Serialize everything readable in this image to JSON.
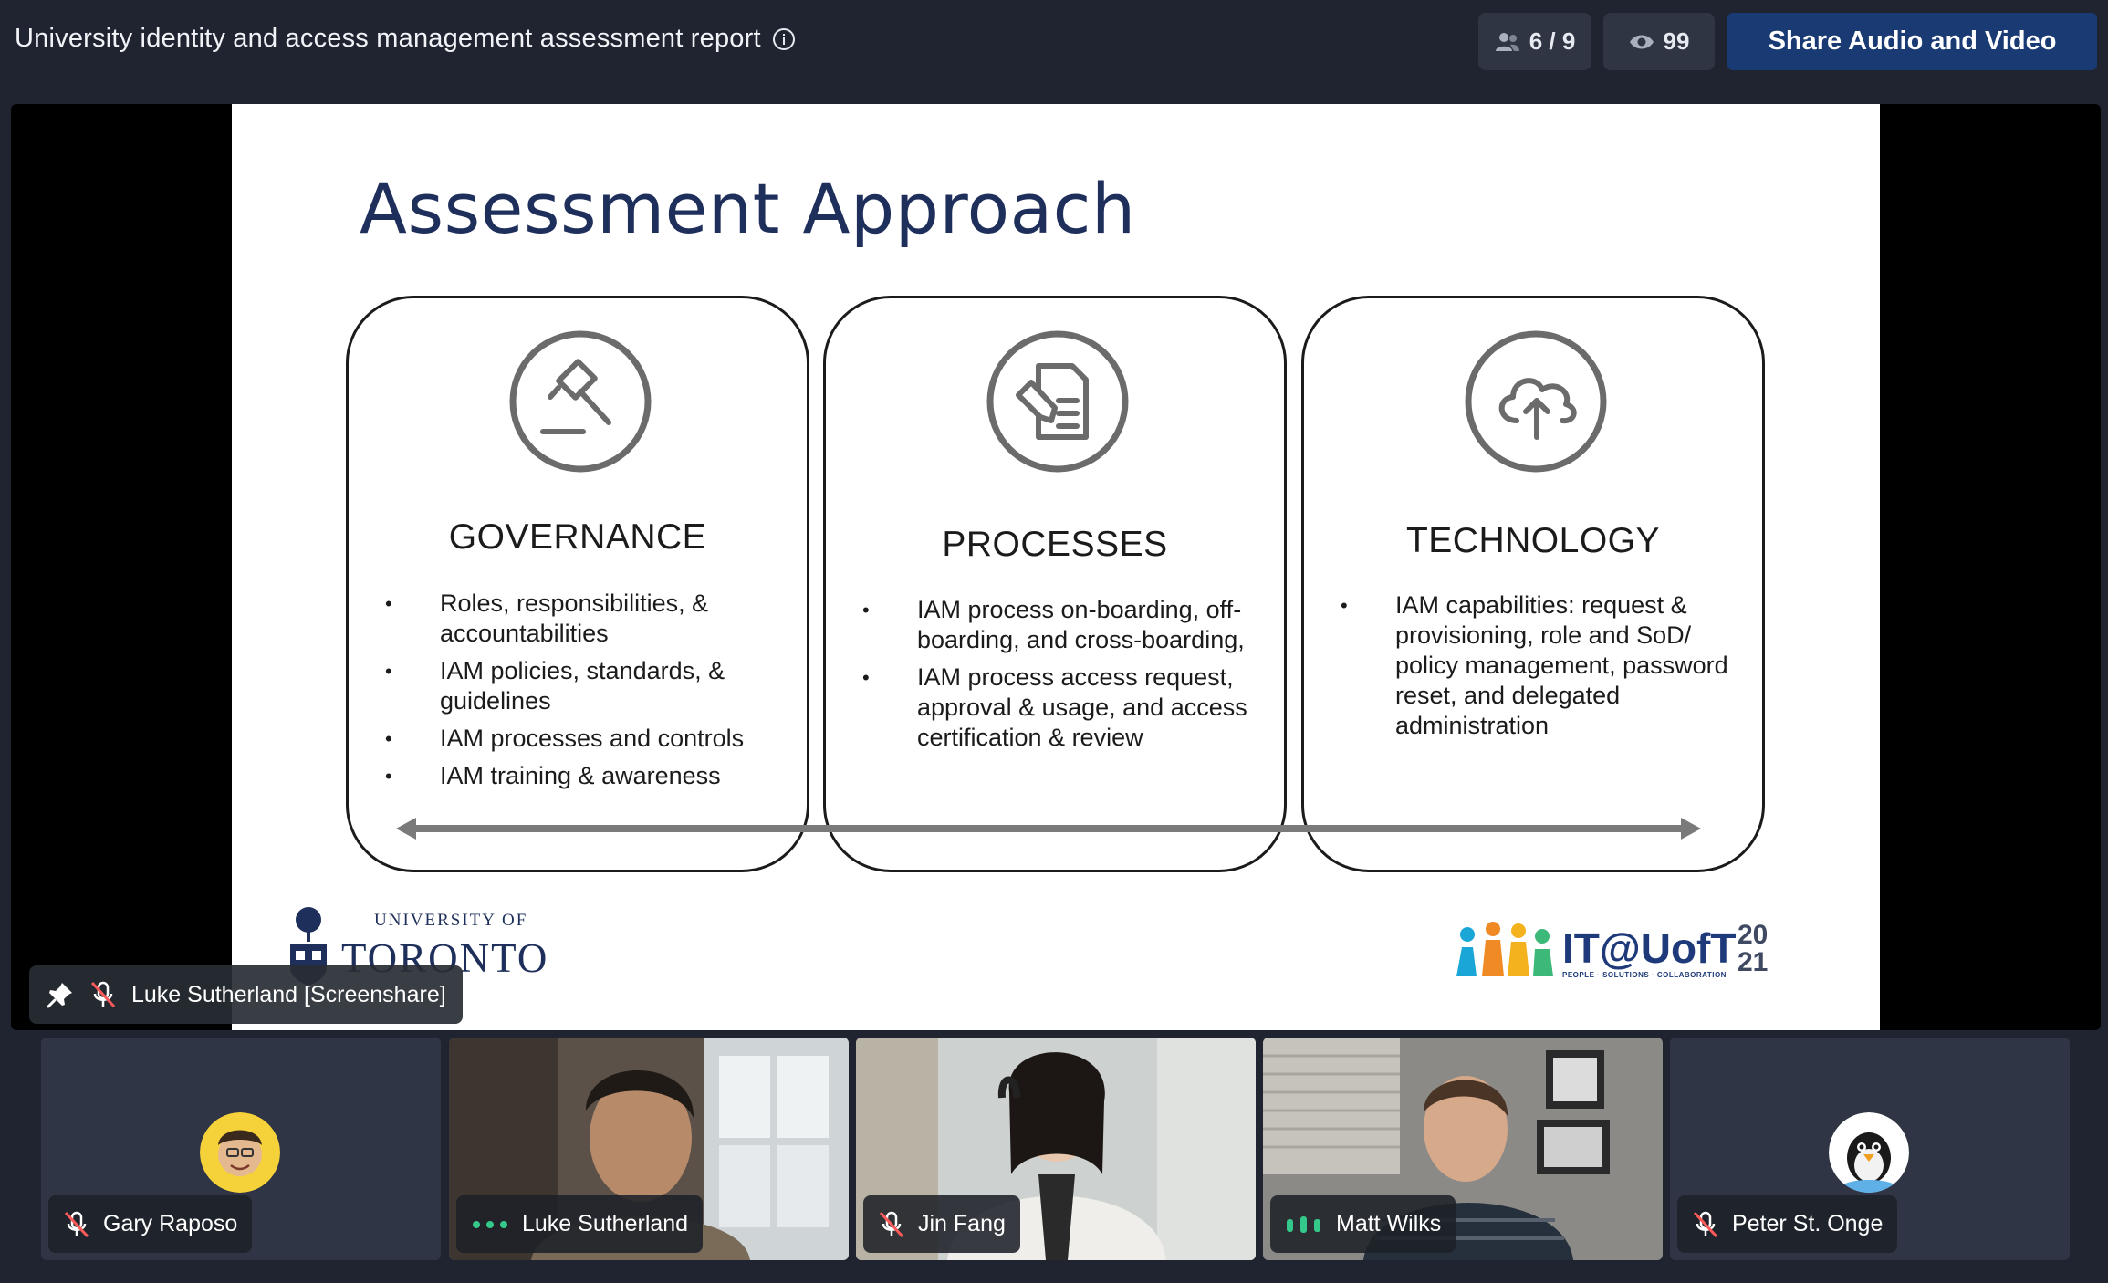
{
  "header": {
    "title": "University identity and access management assessment report",
    "participants_count": "6 / 9",
    "viewers_count": "99",
    "share_button": "Share Audio and Video"
  },
  "slide": {
    "title": "Assessment Approach",
    "panels": [
      {
        "heading": "GOVERNANCE",
        "icon": "gavel-icon",
        "bullets": [
          "Roles, responsibilities, & accountabilities",
          "IAM policies, standards, & guidelines",
          "IAM processes and controls",
          "IAM training & awareness"
        ]
      },
      {
        "heading": "PROCESSES",
        "icon": "document-edit-icon",
        "bullets": [
          "IAM process on-boarding, off-boarding, and cross-boarding,",
          "IAM process access request, approval & usage, and access certification & review"
        ]
      },
      {
        "heading": "TECHNOLOGY",
        "icon": "cloud-upload-icon",
        "bullets": [
          "IAM capabilities: request & provisioning, role and SoD/ policy management, password reset, and delegated administration"
        ]
      }
    ],
    "logo_left": {
      "line1": "UNIVERSITY OF",
      "line2": "TORONTO"
    },
    "logo_right": {
      "name": "IT@UofT",
      "tagline": "PEOPLE · SOLUTIONS · COLLABORATION",
      "year_top": "20",
      "year_bottom": "21"
    }
  },
  "stage_label": "Luke Sutherland [Screenshare]",
  "participants": [
    {
      "name": "Gary Raposo",
      "status": "muted"
    },
    {
      "name": "Luke Sutherland",
      "status": "speaking"
    },
    {
      "name": "Jin Fang",
      "status": "muted"
    },
    {
      "name": "Matt Wilks",
      "status": "active"
    },
    {
      "name": "Peter St. Onge",
      "status": "muted"
    }
  ],
  "colors": {
    "background": "#1f2430",
    "tile": "#2f3544",
    "share_button": "#1a3a73",
    "slide_title": "#1f2f5c"
  }
}
